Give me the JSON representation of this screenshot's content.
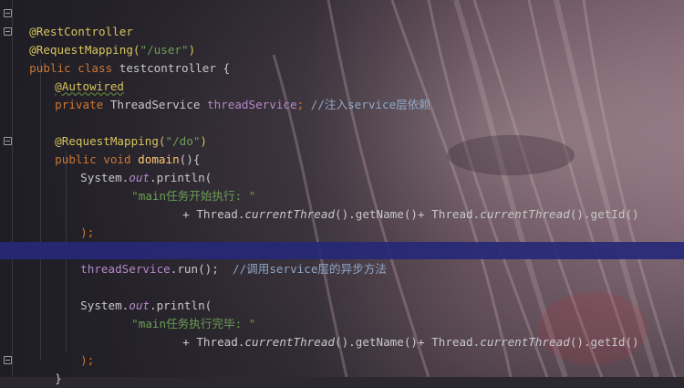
{
  "editor": {
    "lines": {
      "l1_ann": "@RestController",
      "l2_ann": "@RequestMapping(",
      "l2_str": "\"/user\"",
      "l2_end": ")",
      "l3_kw": "public class ",
      "l3_name": "testcontroller {",
      "l4_ann": "@Autowired",
      "l5_kw": "private ",
      "l5_type": "ThreadService ",
      "l5_field": "threadService",
      "l5_semi": "; ",
      "l5_comment": "//注入service层依赖",
      "l7_ann": "@RequestMapping(",
      "l7_str": "\"/do\"",
      "l7_end": ")",
      "l8_kw": "public void ",
      "l8_fn": "domain",
      "l8_end": "(){",
      "l9_a": "System.",
      "l9_out": "out",
      "l9_b": ".println(",
      "l10_str": "\"main任务开始执行: \"",
      "l11_a": "+ Thread.",
      "l11_call1": "currentThread",
      "l11_b": "().getName()+ Thread.",
      "l11_call2": "currentThread",
      "l11_c": "().getId()",
      "l12": ");",
      "l14_field": "threadService",
      "l14_rest": ".run();  ",
      "l14_comment": "//调用service层的异步方法",
      "l16_a": "System.",
      "l16_out": "out",
      "l16_b": ".println(",
      "l17_str": "\"main任务执行完毕: \"",
      "l18_a": "+ Thread.",
      "l18_call1": "currentThread",
      "l18_b": "().getName()+ Thread.",
      "l18_call2": "currentThread",
      "l18_c": "().getId()",
      "l19": ");",
      "l20": "}"
    }
  }
}
